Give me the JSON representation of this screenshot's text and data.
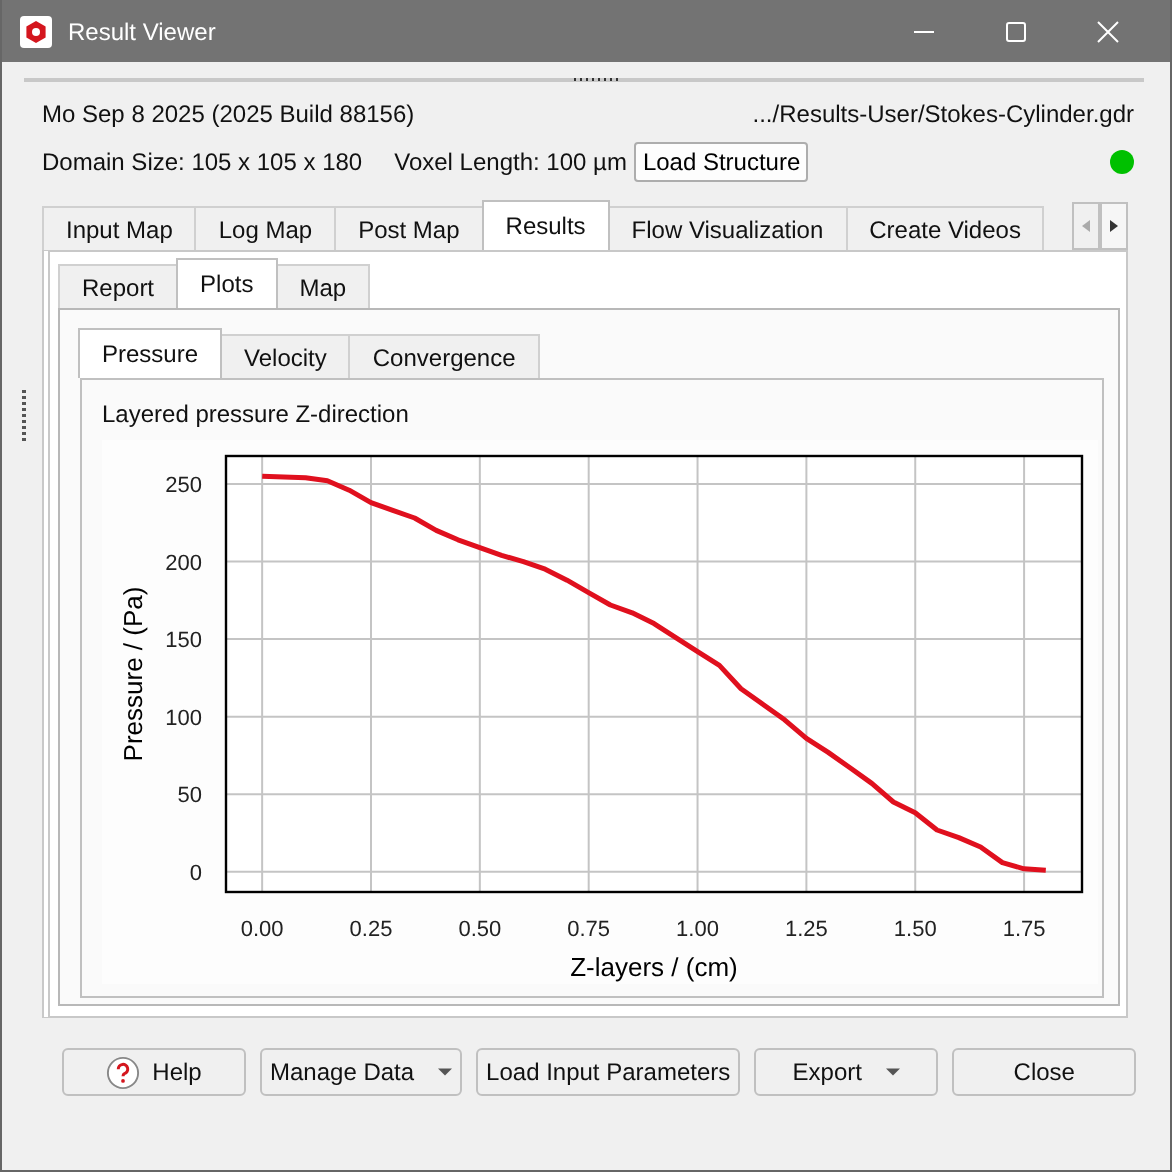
{
  "window": {
    "title": "Result Viewer"
  },
  "info": {
    "date": "Mo Sep 8 2025 (2025 Build 88156)",
    "file": ".../Results-User/Stokes-Cylinder.gdr",
    "domain": "Domain Size: 105 x 105 x 180",
    "voxel": "Voxel Length: 100 µm",
    "load_button": "Load Structure"
  },
  "tabs": [
    {
      "label": "Input Map",
      "selected": false
    },
    {
      "label": "Log Map",
      "selected": false
    },
    {
      "label": "Post Map",
      "selected": false
    },
    {
      "label": "Results",
      "selected": true
    },
    {
      "label": "Flow Visualization",
      "selected": false
    },
    {
      "label": "Create Videos",
      "selected": false
    }
  ],
  "subtabs": [
    {
      "label": "Report",
      "selected": false
    },
    {
      "label": "Plots",
      "selected": true
    },
    {
      "label": "Map",
      "selected": false
    }
  ],
  "plot_tabs": [
    {
      "label": "Pressure",
      "selected": true
    },
    {
      "label": "Velocity",
      "selected": false
    },
    {
      "label": "Convergence",
      "selected": false
    }
  ],
  "plot": {
    "caption": "Layered pressure Z-direction",
    "chart_data": {
      "type": "line",
      "grid": true,
      "xlabel": "Z-layers / (cm)",
      "ylabel": "Pressure / (Pa)",
      "xlim": [
        -0.083,
        1.883
      ],
      "ylim": [
        -13,
        268
      ],
      "xticks": [
        {
          "value": 0,
          "label": "0.00"
        },
        {
          "value": 0.25,
          "label": "0.25"
        },
        {
          "value": 0.5,
          "label": "0.50"
        },
        {
          "value": 0.75,
          "label": "0.75"
        },
        {
          "value": 1,
          "label": "1.00"
        },
        {
          "value": 1.25,
          "label": "1.25"
        },
        {
          "value": 1.5,
          "label": "1.50"
        },
        {
          "value": 1.75,
          "label": "1.75"
        }
      ],
      "yticks": [
        0,
        50,
        100,
        150,
        200,
        250
      ],
      "x": [
        0,
        0.1,
        0.15,
        0.2,
        0.25,
        0.3,
        0.35,
        0.4,
        0.45,
        0.5,
        0.55,
        0.6,
        0.65,
        0.7,
        0.75,
        0.8,
        0.85,
        0.9,
        0.95,
        1.0,
        1.05,
        1.1,
        1.15,
        1.2,
        1.25,
        1.3,
        1.35,
        1.4,
        1.45,
        1.5,
        1.55,
        1.6,
        1.65,
        1.7,
        1.75,
        1.8
      ],
      "series": [
        {
          "color": "#e0101e",
          "values": [
            255,
            254,
            252,
            246,
            238,
            233,
            228,
            220,
            214,
            209,
            204,
            200,
            195,
            188,
            180,
            172,
            167,
            160,
            151,
            142,
            133,
            118,
            108,
            98,
            86,
            77,
            67,
            57,
            45,
            38,
            27,
            22,
            16,
            6,
            2,
            1
          ]
        }
      ]
    }
  },
  "buttons": [
    {
      "label": "Help",
      "kind": "help"
    },
    {
      "label": "Manage Data",
      "kind": "dropdown"
    },
    {
      "label": "Load Input Parameters",
      "kind": "plain"
    },
    {
      "label": "Export",
      "kind": "dropdown"
    },
    {
      "label": "Close",
      "kind": "plain"
    }
  ]
}
